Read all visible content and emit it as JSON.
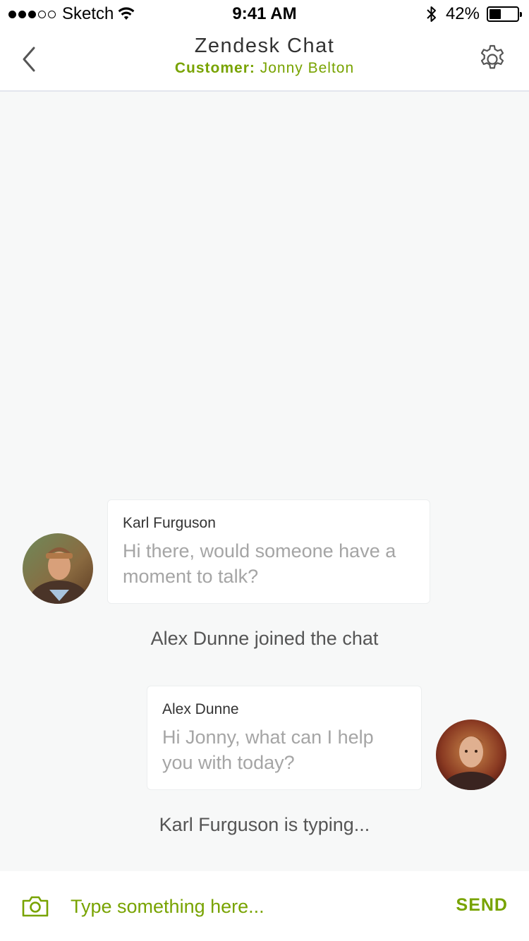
{
  "status_bar": {
    "carrier": "Sketch",
    "time": "9:41 AM",
    "battery_percent": "42%",
    "battery_level": 0.42,
    "signal_bars_filled": 3,
    "signal_bars_total": 5
  },
  "nav": {
    "title": "Zendesk Chat",
    "customer_label": "Customer:",
    "customer_name": "Jonny Belton",
    "back_icon": "chevron-left-icon",
    "settings_icon": "gear-icon"
  },
  "messages": [
    {
      "sender": "Karl Furguson",
      "text": "Hi there, would someone have a moment to talk?",
      "side": "left"
    },
    {
      "sender": "Alex Dunne",
      "text": "Hi Jonny, what can I help you with today?",
      "side": "right"
    }
  ],
  "system": {
    "joined": "Alex Dunne joined the chat",
    "typing": "Karl Furguson is typing..."
  },
  "composer": {
    "placeholder": "Type something here...",
    "send_label": "SEND",
    "camera_icon": "camera-icon"
  },
  "colors": {
    "accent": "#78a300",
    "background": "#f7f8f8",
    "bubble": "#ffffff",
    "message_text": "#a5a5a5"
  }
}
